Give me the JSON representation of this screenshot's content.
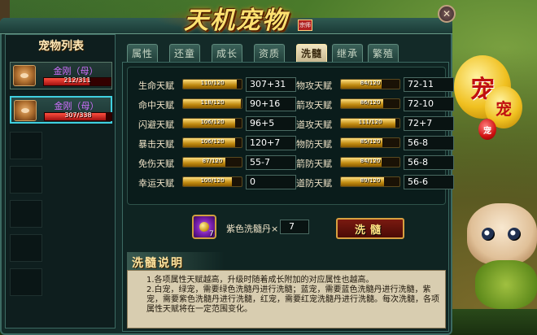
{
  "window": {
    "title": "天机宠物",
    "title_seal": "宗师",
    "close_label": "✕"
  },
  "pet_list": {
    "title": "宠物列表",
    "pets": [
      {
        "name": "金刚（母）",
        "hp_text": "212/311",
        "hp_fraction": 0.68,
        "selected": false
      },
      {
        "name": "金刚（母）",
        "hp_text": "307/338",
        "hp_fraction": 0.91,
        "selected": true
      }
    ]
  },
  "tabs": [
    {
      "label": "属性",
      "active": false
    },
    {
      "label": "还童",
      "active": false
    },
    {
      "label": "成长",
      "active": false
    },
    {
      "label": "资质",
      "active": false
    },
    {
      "label": "洗髓",
      "active": true
    },
    {
      "label": "继承",
      "active": false
    },
    {
      "label": "繁殖",
      "active": false
    }
  ],
  "stats": [
    {
      "label": "生命天赋",
      "bar_text": "110/120",
      "fraction": 0.917,
      "value": "307+31"
    },
    {
      "label": "命中天赋",
      "bar_text": "118/120",
      "fraction": 0.983,
      "value": "90+16"
    },
    {
      "label": "闪避天赋",
      "bar_text": "106/120",
      "fraction": 0.883,
      "value": "96+5"
    },
    {
      "label": "暴击天赋",
      "bar_text": "106/120",
      "fraction": 0.883,
      "value": "120+7"
    },
    {
      "label": "免伤天赋",
      "bar_text": "87/120",
      "fraction": 0.725,
      "value": "55-7"
    },
    {
      "label": "幸运天赋",
      "bar_text": "100/120",
      "fraction": 0.833,
      "value": "0"
    },
    {
      "label": "物攻天赋",
      "bar_text": "84/120",
      "fraction": 0.7,
      "value": "72-11"
    },
    {
      "label": "箭攻天赋",
      "bar_text": "86/120",
      "fraction": 0.717,
      "value": "72-10"
    },
    {
      "label": "道攻天赋",
      "bar_text": "111/120",
      "fraction": 0.925,
      "value": "72+7"
    },
    {
      "label": "物防天赋",
      "bar_text": "85/120",
      "fraction": 0.708,
      "value": "56-8"
    },
    {
      "label": "箭防天赋",
      "bar_text": "84/120",
      "fraction": 0.7,
      "value": "56-8"
    },
    {
      "label": "道防天赋",
      "bar_text": "89/120",
      "fraction": 0.742,
      "value": "56-6"
    }
  ],
  "wash": {
    "item_count": "7",
    "item_label": "紫色洗髓丹×",
    "quantity": "7",
    "button_label": "洗髓"
  },
  "description": {
    "title": "洗髓说明",
    "lines": [
      "1.各项属性天赋越高，升级时随着成长附加的对应属性也越高。",
      "2.白宠，绿宠，需要绿色洗髓丹进行洗髓；蓝宠，需要蓝色洗髓丹进行洗髓，紫宠，需要紫色洗髓丹进行洗髓，红宠，需要红宠洗髓丹进行洗髓。每次洗髓，各项属性天赋将在一定范围变化。"
    ]
  },
  "side_decor": {
    "balloon_big": "宠",
    "balloon_mid": "宠",
    "balloon_small": "宠"
  }
}
